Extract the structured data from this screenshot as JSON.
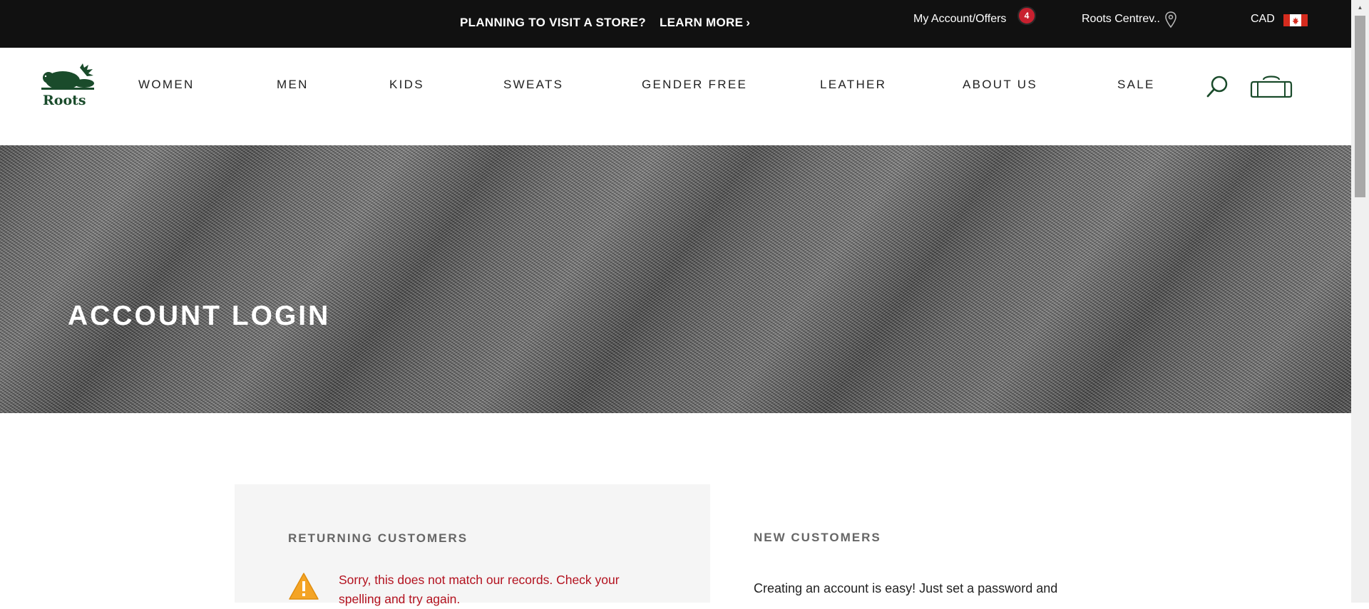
{
  "promo_bar": {
    "text": "PLANNING TO VISIT A STORE?",
    "link": "LEARN MORE",
    "link_chevron": "›"
  },
  "utility": {
    "account_label": "My Account/Offers",
    "offers_count": "4",
    "store_label": "Roots Centrev..",
    "store_icon": "map-pin-icon",
    "currency": "CAD",
    "flag_icon": "canada-flag-icon"
  },
  "brand": {
    "logo_text": "Roots",
    "logo_icon": "beaver-logo-icon",
    "logo_color": "#1a4b2b"
  },
  "nav": {
    "items": [
      {
        "label": "WOMEN"
      },
      {
        "label": "MEN"
      },
      {
        "label": "KIDS"
      },
      {
        "label": "SWEATS"
      },
      {
        "label": "GENDER FREE"
      },
      {
        "label": "LEATHER"
      },
      {
        "label": "ABOUT US"
      },
      {
        "label": "SALE"
      }
    ],
    "search_icon": "search-icon",
    "cart_icon": "bag-icon"
  },
  "hero": {
    "title": "ACCOUNT LOGIN"
  },
  "returning": {
    "title": "RETURNING CUSTOMERS",
    "error_icon": "warning-icon",
    "error_message": "Sorry, this does not match our records. Check your spelling and try again."
  },
  "new_customers": {
    "title": "NEW CUSTOMERS",
    "description": "Creating an account is easy! Just set a password and"
  },
  "colors": {
    "topbar": "#111111",
    "error": "#b3121f",
    "badge": "#c8202f",
    "panel": "#f5f5f5"
  }
}
